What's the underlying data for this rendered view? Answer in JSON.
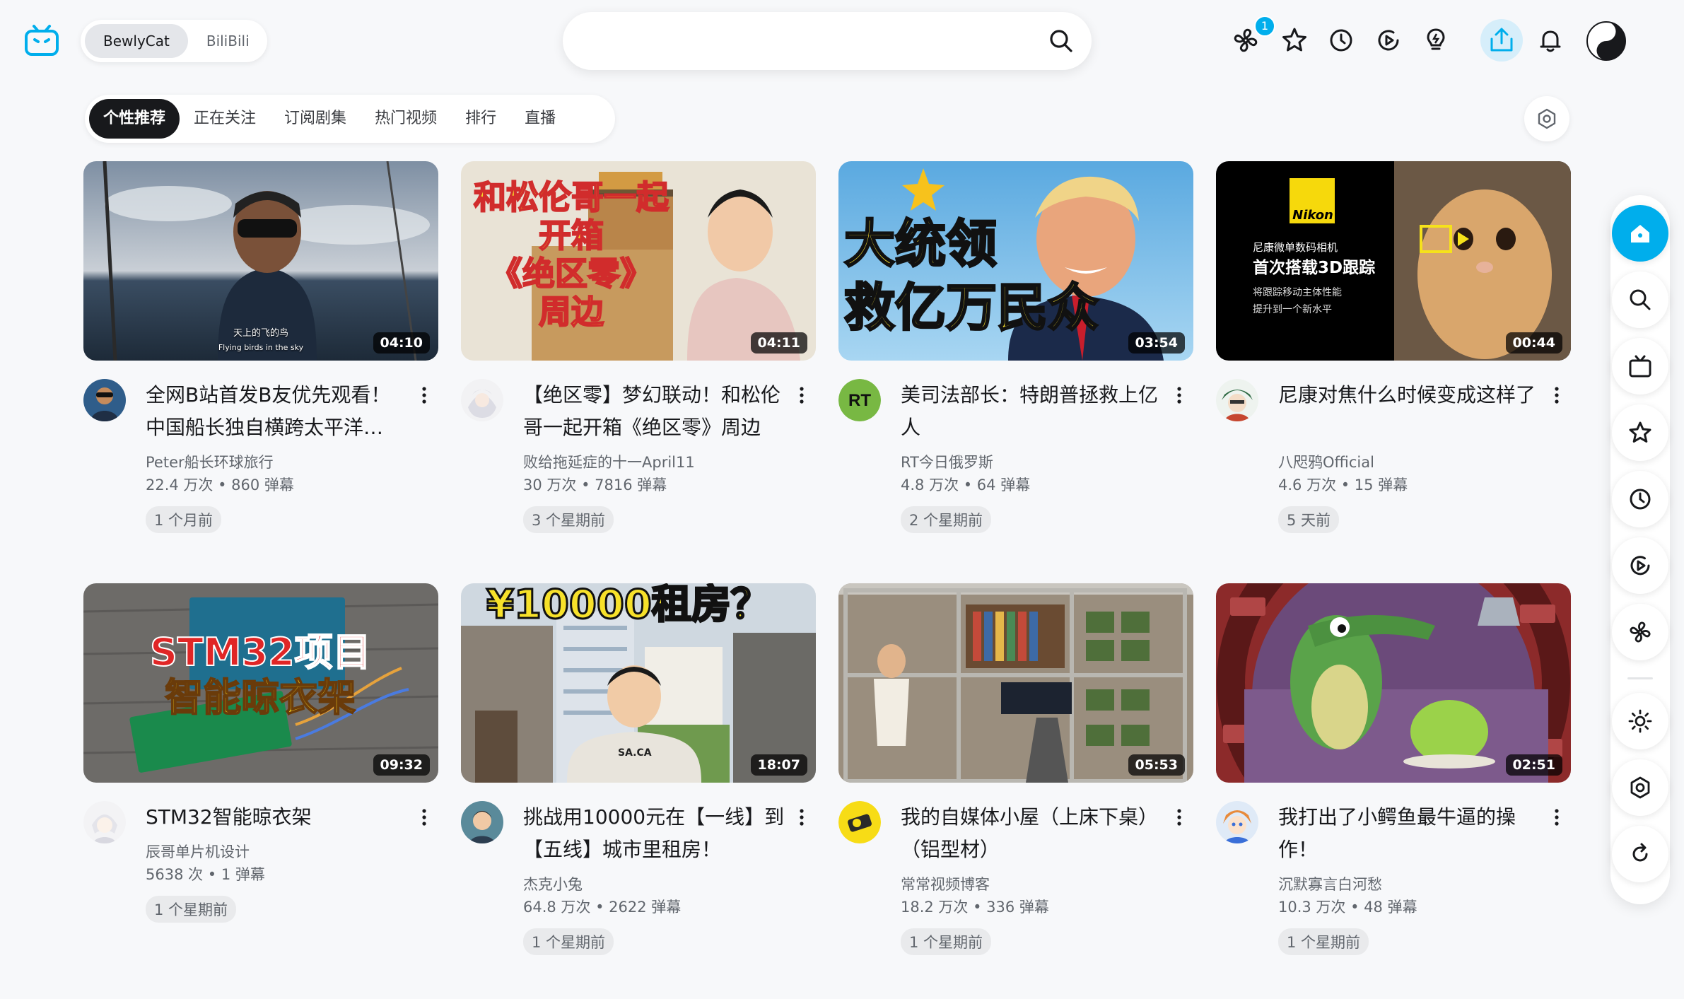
{
  "header": {
    "switch": [
      "BewlyCat",
      "BiliBili"
    ],
    "search_placeholder": "",
    "badge_count": "1"
  },
  "tabs": [
    "个性推荐",
    "正在关注",
    "订阅剧集",
    "热门视频",
    "排行",
    "直播"
  ],
  "videos": [
    {
      "title": "全网B站首发B友优先观看！中国船长独自横跨太平洋…",
      "author": "Peter船长环球旅行",
      "stats": "22.4 万次 • 860 弹幕",
      "date": "1 个月前",
      "duration": "04:10",
      "thumb_text": [
        "天上的飞的鸟",
        "Flying birds in the sky"
      ]
    },
    {
      "title": "【绝区零】梦幻联动！和松伦哥一起开箱《绝区零》周边",
      "author": "败给拖延症的十一April11",
      "stats": "30 万次 • 7816 弹幕",
      "date": "3 个星期前",
      "duration": "04:11",
      "thumb_text": [
        "和松伦哥一起",
        "开箱",
        "《绝区零》",
        "周边"
      ]
    },
    {
      "title": "美司法部长：特朗普拯救上亿人",
      "author": "RT今日俄罗斯",
      "stats": "4.8 万次 • 64 弹幕",
      "date": "2 个星期前",
      "duration": "03:54",
      "thumb_text": [
        "大统领",
        "救亿万民众"
      ]
    },
    {
      "title": "尼康对焦什么时候变成这样了",
      "author": "八咫鸦Official",
      "stats": "4.6 万次 • 15 弹幕",
      "date": "5 天前",
      "duration": "00:44",
      "thumb_text": [
        "Nikon",
        "尼康微单数码相机",
        "首次搭载3D跟踪",
        "将跟踪移动主体性能",
        "提升到一个新水平"
      ]
    },
    {
      "title": "STM32智能晾衣架",
      "author": "辰哥单片机设计",
      "stats": "5638 次 • 1 弹幕",
      "date": "1 个星期前",
      "duration": "09:32",
      "thumb_text": [
        "STM32项目",
        "智能晾衣架"
      ]
    },
    {
      "title": "挑战用10000元在【一线】到【五线】城市里租房！",
      "author": "杰克小兔",
      "stats": "64.8 万次 • 2622 弹幕",
      "date": "1 个星期前",
      "duration": "18:07",
      "thumb_text": [
        "¥10000租房？",
        "SA.CA"
      ]
    },
    {
      "title": "我的自媒体小屋（上床下桌）（铝型材）",
      "author": "常常视频博客",
      "stats": "18.2 万次 • 336 弹幕",
      "date": "1 个星期前",
      "duration": "05:53",
      "thumb_text": []
    },
    {
      "title": "我打出了小鳄鱼最牛逼的操作！",
      "author": "沉默寡言白河愁",
      "stats": "10.3 万次 • 48 弹幕",
      "date": "1 个星期前",
      "duration": "02:51",
      "thumb_text": []
    }
  ],
  "avatar_texts": {
    "rt": "RT"
  },
  "colors": {
    "accent": "#00aeec",
    "brand_pink": "#fb7299"
  },
  "icons": [
    "bilibili-tv-logo",
    "search-icon",
    "fan-icon",
    "star-icon",
    "clock-icon",
    "play-circle-icon",
    "lightbulb-icon",
    "upload-icon",
    "bell-icon",
    "yin-yang-avatar",
    "settings-icon",
    "home-icon",
    "tv-icon",
    "sun-icon",
    "refresh-icon",
    "more-vertical-icon"
  ]
}
